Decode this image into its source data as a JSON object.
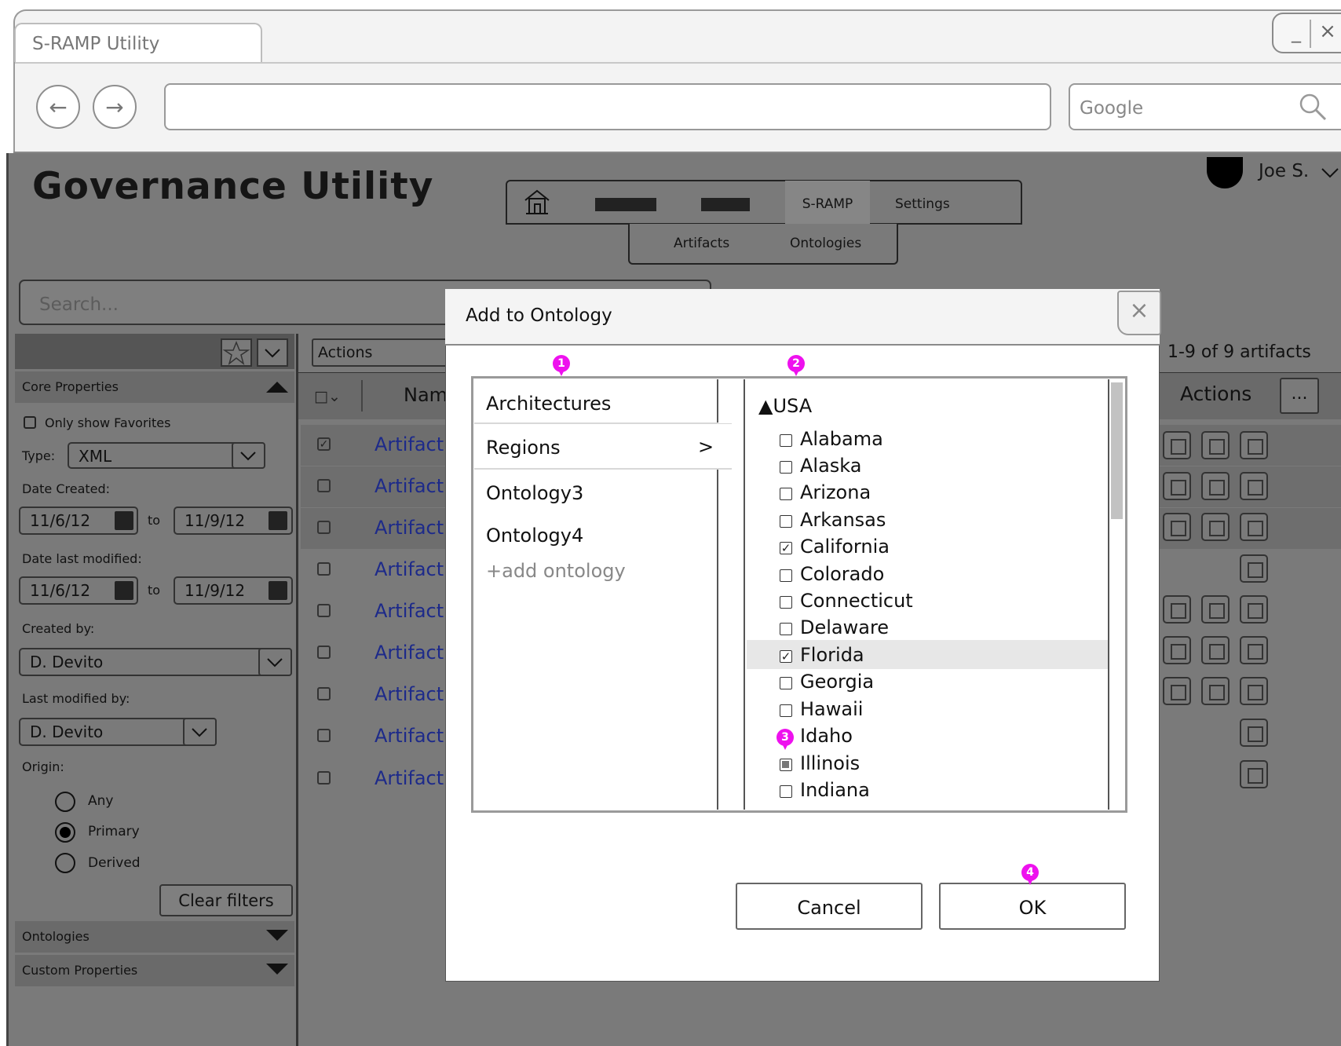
{
  "browser": {
    "tab_title": "S-RAMP Utility",
    "window_minimize": "_",
    "window_close": "×",
    "url": "",
    "search_placeholder": "Google",
    "back_icon": "back-arrow-icon",
    "forward_icon": "forward-arrow-icon"
  },
  "app": {
    "title": "Governance Utility",
    "nav": {
      "home_icon": "home-icon",
      "tabs": [
        "S-RAMP",
        "Settings"
      ],
      "active_tab": "S-RAMP"
    },
    "subnav": [
      "Artifacts",
      "Ontologies"
    ],
    "user": {
      "name": "Joe S."
    },
    "search_placeholder": "Search..."
  },
  "filters": {
    "core_properties": "Core Properties",
    "only_favorites": "Only show Favorites",
    "type_label": "Type:",
    "type_value": "XML",
    "date_created_label": "Date Created:",
    "date_created_from": "11/6/12",
    "date_created_to": "11/9/12",
    "date_modified_label": "Date last modified:",
    "date_modified_from": "11/6/12",
    "date_modified_to": "11/9/12",
    "to": "to",
    "created_by_label": "Created by:",
    "created_by_value": "D. Devito",
    "modified_by_label": "Last modified by:",
    "modified_by_value": "D. Devito",
    "origin_label": "Origin:",
    "origin_options": [
      "Any",
      "Primary",
      "Derived"
    ],
    "origin_selected": "Primary",
    "clear_filters": "Clear filters",
    "ontologies": "Ontologies",
    "custom_properties": "Custom Properties"
  },
  "list": {
    "actions_dropdown": "Actions",
    "count_text": "1-9 of 9 artifacts",
    "columns": [
      "Nam",
      "Actions"
    ],
    "more_button": "...",
    "rows": [
      {
        "name": "Artifact",
        "checked": true
      },
      {
        "name": "Artifact",
        "checked": false
      },
      {
        "name": "Artifact",
        "checked": false
      },
      {
        "name": "Artifact",
        "checked": false
      },
      {
        "name": "Artifact",
        "checked": false
      },
      {
        "name": "Artifact",
        "checked": false
      },
      {
        "name": "Artifact",
        "checked": false
      },
      {
        "name": "Artifact",
        "checked": false
      },
      {
        "name": "Artifact",
        "checked": false
      }
    ]
  },
  "modal": {
    "title": "Add to Ontology",
    "close": "×",
    "ontologies": [
      "Architectures",
      "Regions",
      "Ontology3",
      "Ontology4"
    ],
    "selected_ontology": "Regions",
    "selected_arrow": ">",
    "add_ontology": "+add ontology",
    "tree_root": "USA",
    "tree_root_marker": "▲",
    "states": [
      {
        "name": "Alabama",
        "state": "unchecked"
      },
      {
        "name": "Alaska",
        "state": "unchecked"
      },
      {
        "name": "Arizona",
        "state": "unchecked"
      },
      {
        "name": "Arkansas",
        "state": "unchecked"
      },
      {
        "name": "California",
        "state": "checked"
      },
      {
        "name": "Colorado",
        "state": "unchecked"
      },
      {
        "name": "Connecticut",
        "state": "unchecked"
      },
      {
        "name": "Delaware",
        "state": "unchecked"
      },
      {
        "name": "Florida",
        "state": "checked"
      },
      {
        "name": "Georgia",
        "state": "unchecked"
      },
      {
        "name": "Hawaii",
        "state": "unchecked"
      },
      {
        "name": "Idaho",
        "state": "none"
      },
      {
        "name": "Illinois",
        "state": "partial"
      },
      {
        "name": "Indiana",
        "state": "unchecked"
      }
    ],
    "highlighted_state": "Florida",
    "cancel": "Cancel",
    "ok": "OK"
  },
  "callouts": [
    "1",
    "2",
    "3",
    "4"
  ],
  "colors": {
    "callout": "#ee11ee",
    "link": "#1d2a8a",
    "overlay": "#7a7a7a"
  }
}
